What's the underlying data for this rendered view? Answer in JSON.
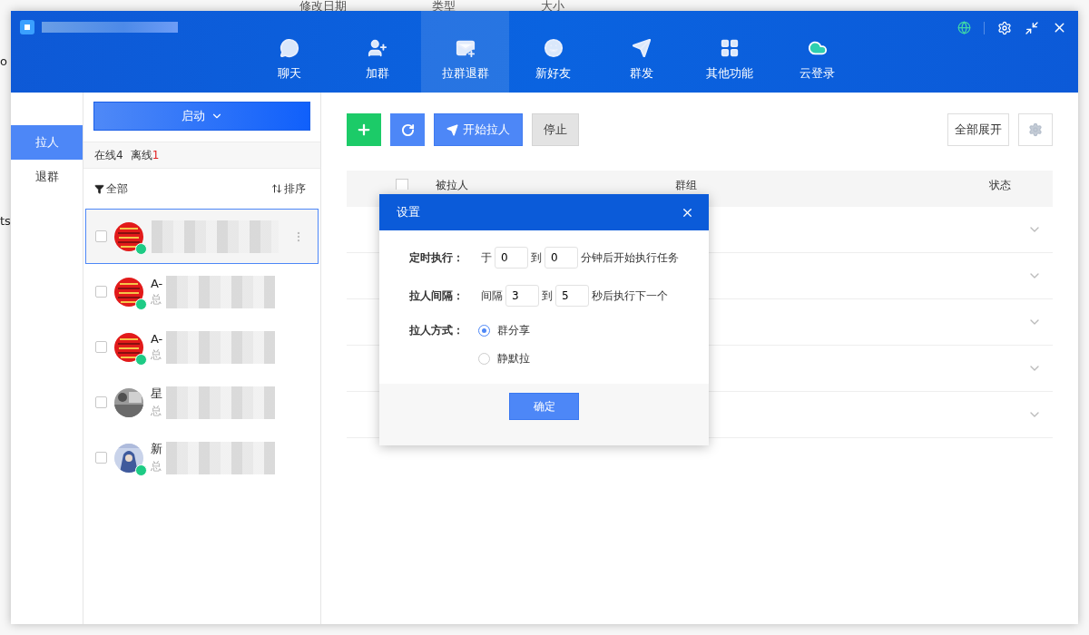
{
  "background_window": {
    "columns": [
      "修改日期",
      "类型",
      "大小"
    ],
    "edge_texts": [
      "o",
      "ts"
    ]
  },
  "nav": [
    {
      "kind": "chat",
      "label": "聊天",
      "selected": false
    },
    {
      "kind": "add",
      "label": "加群",
      "selected": false
    },
    {
      "kind": "mail",
      "label": "拉群退群",
      "selected": true
    },
    {
      "kind": "smile",
      "label": "新好友",
      "selected": false
    },
    {
      "kind": "send",
      "label": "群发",
      "selected": false
    },
    {
      "kind": "grid",
      "label": "其他功能",
      "selected": false
    },
    {
      "kind": "cloud",
      "label": "云登录",
      "selected": false
    }
  ],
  "side_menu": [
    {
      "label": "拉人",
      "selected": true
    },
    {
      "label": "退群",
      "selected": false
    }
  ],
  "contacts_panel": {
    "start_button": "启动",
    "online_label": "在线",
    "online_count": "4",
    "offline_label": "离线",
    "offline_count": "1",
    "filter": "全部",
    "sort": "排序",
    "contacts": [
      {
        "selected": true,
        "checked": false,
        "online": true
      },
      {
        "name": "A-",
        "subtitle": "总",
        "selected": false,
        "checked": false,
        "online": true
      },
      {
        "name": "A-",
        "subtitle": "总",
        "selected": false,
        "checked": false,
        "online": true
      },
      {
        "name": "星",
        "subtitle": "总",
        "selected": false,
        "checked": false,
        "online": false
      },
      {
        "name": "新",
        "subtitle": "总",
        "selected": false,
        "checked": false,
        "online": true
      }
    ]
  },
  "toolbar": {
    "start": "开始拉人",
    "stop": "停止",
    "expand_all": "全部展开"
  },
  "table": {
    "select_all_checked": false,
    "columns": [
      "被拉人",
      "群组",
      "状态"
    ],
    "rows": [
      {
        "expanded": false
      },
      {
        "expanded": false
      },
      {
        "expanded": false
      },
      {
        "expanded": false
      },
      {
        "expanded": false
      }
    ]
  },
  "dialog": {
    "title": "设置",
    "fields": [
      {
        "label": "定时执行：",
        "prefix": "于",
        "from": "0",
        "sep": "到",
        "to": "0",
        "suffix": "分钟后开始执行任务"
      },
      {
        "label": "拉人间隔：",
        "prefix": "间隔",
        "from": "3",
        "sep": "到",
        "to": "5",
        "suffix": "秒后执行下一个"
      }
    ],
    "method_label": "拉人方式：",
    "options": [
      {
        "label": "群分享",
        "selected": true
      },
      {
        "label": "静默拉",
        "selected": false
      }
    ],
    "ok": "确定"
  }
}
